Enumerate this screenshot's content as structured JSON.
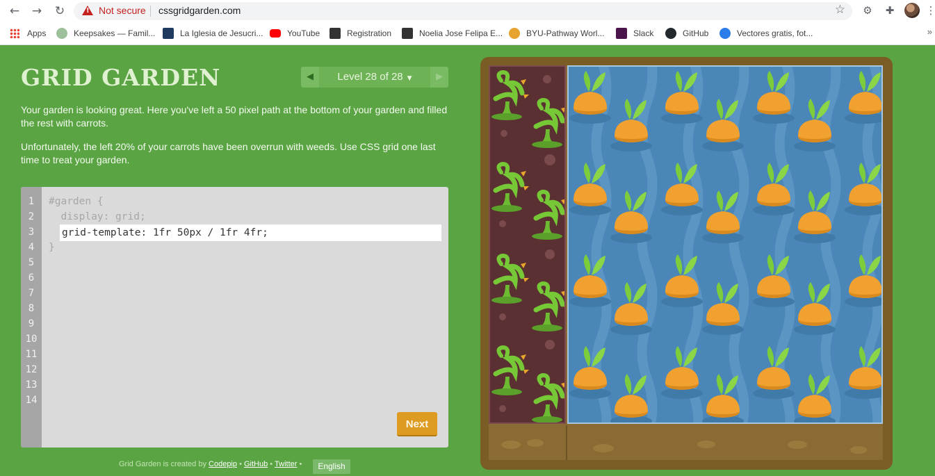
{
  "browser": {
    "not_secure": "Not secure",
    "url": "cssgridgarden.com",
    "bookmarks": [
      {
        "label": "Apps",
        "color": "#ea4335"
      },
      {
        "label": "Keepsakes — Famil...",
        "color": "#9cc19a"
      },
      {
        "label": "La Iglesia de Jesucri...",
        "color": "#1f3a5f"
      },
      {
        "label": "YouTube",
        "color": "#ff0000"
      },
      {
        "label": "Registration",
        "color": "#333333"
      },
      {
        "label": "Noelia Jose Felipa E...",
        "color": "#333333"
      },
      {
        "label": "BYU-Pathway Worl...",
        "color": "#e6a330"
      },
      {
        "label": "Slack",
        "color": "#4a154b"
      },
      {
        "label": "GitHub",
        "color": "#24292e"
      },
      {
        "label": "Vectores gratis, fot...",
        "color": "#2b7de9"
      }
    ],
    "more": "»"
  },
  "game": {
    "title": "GRID GARDEN",
    "level_label": "Level 28 of 28",
    "instructions": [
      "Your garden is looking great. Here you've left a 50 pixel path at the bottom of your garden and filled the rest with carrots.",
      "Unfortunately, the left 20% of your carrots have been overrun with weeds. Use CSS grid one last time to treat your garden."
    ],
    "code_lines": [
      "#garden {",
      "  display: grid;",
      "",
      "}"
    ],
    "input_value": "grid-template: 1fr 50px / 1fr 4fr;",
    "line_numbers": [
      "1",
      "2",
      "3",
      "4",
      "5",
      "6",
      "7",
      "8",
      "9",
      "10",
      "11",
      "12",
      "13",
      "14"
    ],
    "next_label": "Next"
  },
  "footer": {
    "prefix": "Grid Garden is created by",
    "codepip": "Codepip",
    "github": "GitHub",
    "twitter": "Twitter",
    "sep": "•",
    "language": "English"
  },
  "colors": {
    "background": "#5aa444",
    "weed_soil": "#5b3033",
    "water": "#4a86b8",
    "carrot": "#f0a130",
    "leaf": "#7ccc3c",
    "next_button": "#de9b22"
  }
}
